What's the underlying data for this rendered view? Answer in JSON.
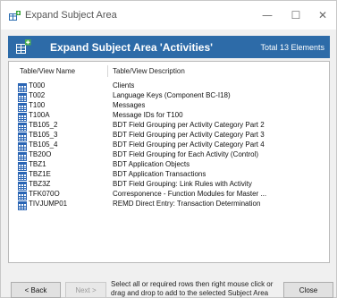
{
  "window": {
    "title": "Expand Subject Area",
    "minimize_glyph": "—",
    "maximize_glyph": "☐",
    "close_glyph": "✕"
  },
  "header": {
    "title": "Expand Subject Area 'Activities'",
    "total": "Total 13 Elements",
    "bg_color": "#2d6ba8"
  },
  "table": {
    "columns": [
      "Table/View Name",
      "Table/View Description"
    ],
    "rows": [
      {
        "name": "T000",
        "description": "Clients"
      },
      {
        "name": "T002",
        "description": "Language Keys (Component BC-I18)"
      },
      {
        "name": "T100",
        "description": "Messages"
      },
      {
        "name": "T100A",
        "description": "Message IDs for T100"
      },
      {
        "name": "TB105_2",
        "description": "BDT Field Grouping per Activity Category Part 2"
      },
      {
        "name": "TB105_3",
        "description": "BDT Field Grouping per Activity Category Part 3"
      },
      {
        "name": "TB105_4",
        "description": "BDT Field Grouping per Activity Category Part 4"
      },
      {
        "name": "TB20O",
        "description": "BDT Field Grouping for Each Activity (Control)"
      },
      {
        "name": "TBZ1",
        "description": "BDT Application Objects"
      },
      {
        "name": "TBZ1E",
        "description": "BDT Application Transactions"
      },
      {
        "name": "TBZ3Z",
        "description": "BDT Field Grouping: Link Rules with Activity"
      },
      {
        "name": "TFK070O",
        "description": "Corresponence - Function Modules for Master ..."
      },
      {
        "name": "TIVJUMP01",
        "description": "REMD Direct Entry: Transaction Determination"
      }
    ]
  },
  "footer": {
    "back_label": "< Back",
    "next_label": "Next >",
    "hint": "Select all or required rows then right mouse click or drag and drop to add to the selected Subject Area",
    "close_label": "Close"
  },
  "icons": {
    "window_icon": "subject-area-icon",
    "header_icon": "subject-area-icon",
    "row_icon": "table-icon"
  }
}
